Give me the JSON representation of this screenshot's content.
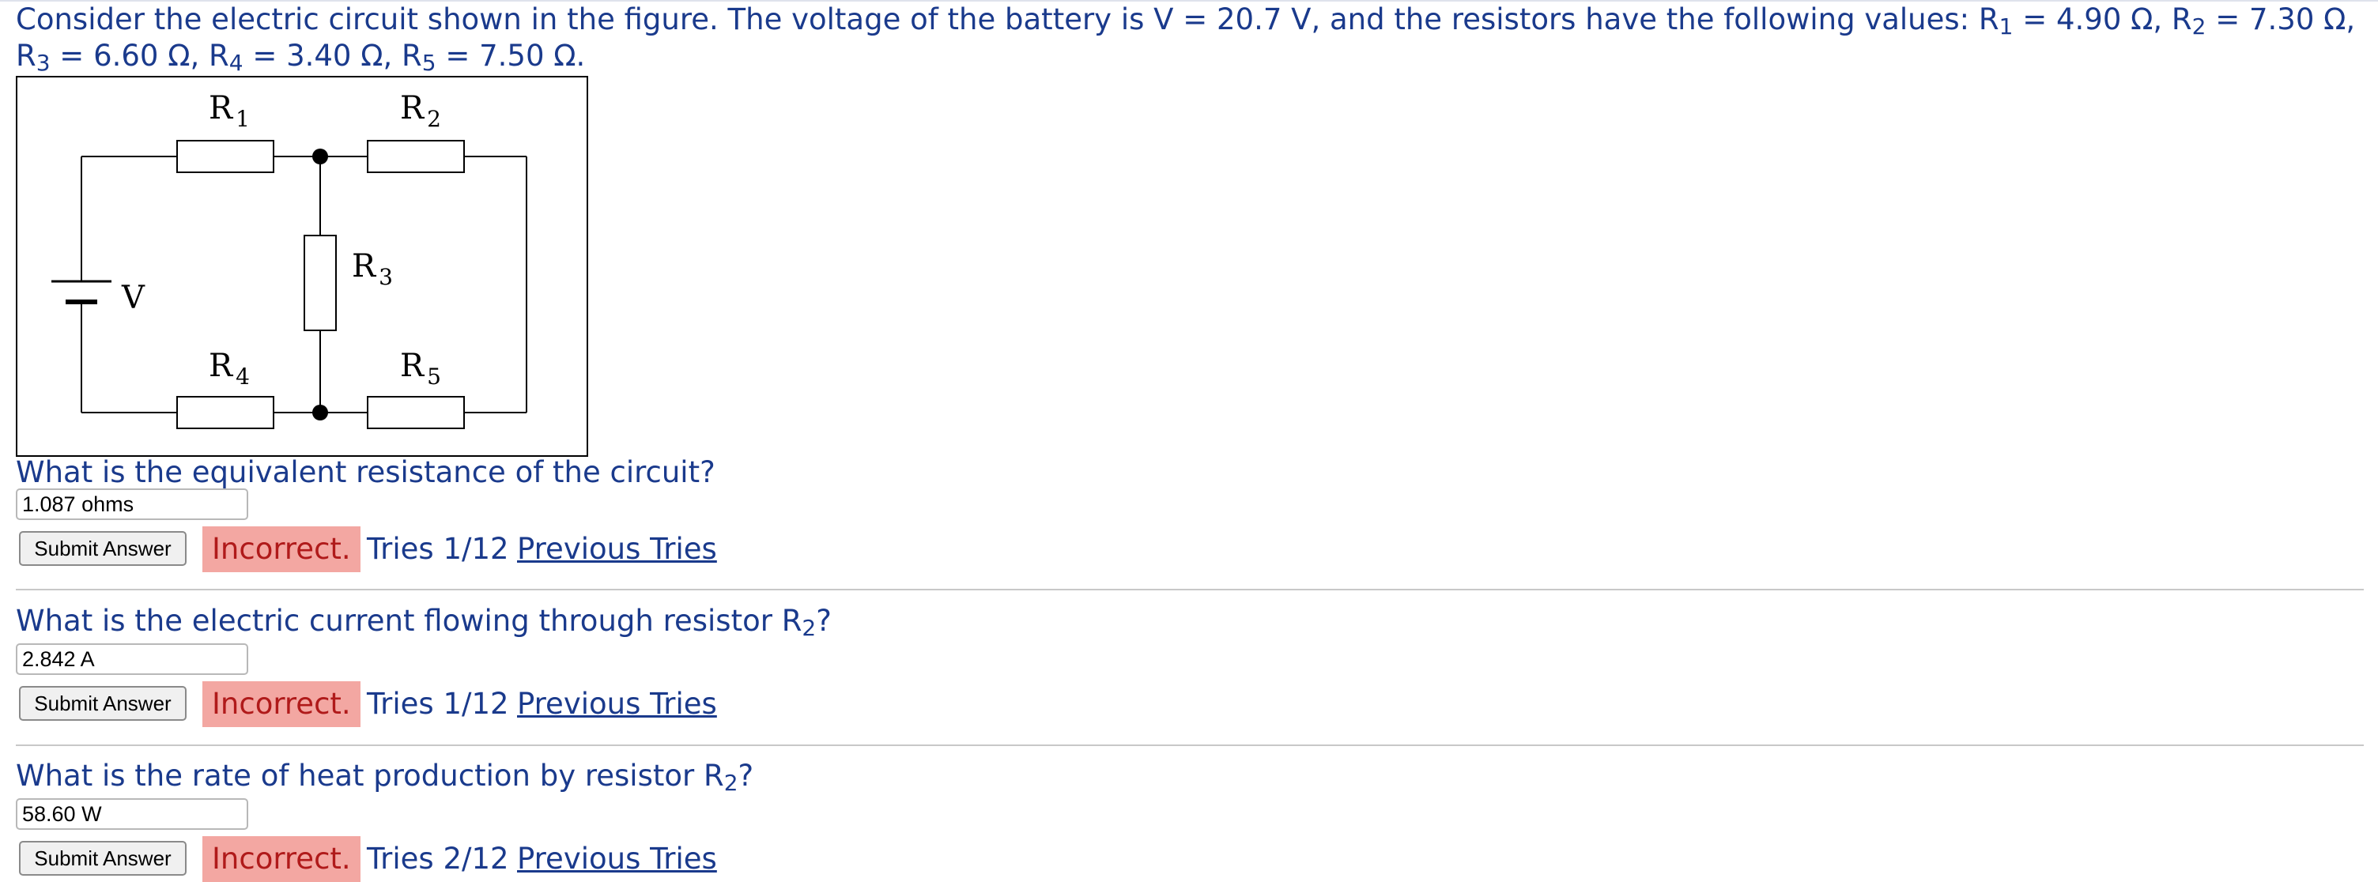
{
  "problem": {
    "intro": "Consider the electric circuit shown in the figure. The voltage of the battery is V = 20.7 V, and the resistors have the following values: R",
    "r1_sub": "1",
    "r1_val": " = 4.90 Ω, R",
    "r2_sub": "2",
    "r2_val": " = 7.30 Ω,",
    "r3_pre": "R",
    "r3_sub": "3",
    "r3_val": " = 6.60 Ω, R",
    "r4_sub": "4",
    "r4_val": " = 3.40 Ω, R",
    "r5_sub": "5",
    "r5_val": " = 7.50 Ω."
  },
  "figure": {
    "labels": {
      "r1": "R",
      "r1_sub": "1",
      "r2": "R",
      "r2_sub": "2",
      "r3": "R",
      "r3_sub": "3",
      "r4": "R",
      "r4_sub": "4",
      "r5": "R",
      "r5_sub": "5",
      "v": "V"
    }
  },
  "questions": [
    {
      "text": "What is the equivalent resistance of the circuit?",
      "answer": "1.087 ohms",
      "submit_label": "Submit Answer",
      "status": "Incorrect.",
      "tries": "Tries 1/12",
      "previous": "Previous Tries"
    },
    {
      "text_pre": "What is the electric current flowing through resistor R",
      "text_sub": "2",
      "text_post": "?",
      "answer": "2.842 A",
      "submit_label": "Submit Answer",
      "status": "Incorrect.",
      "tries": "Tries 1/12",
      "previous": "Previous Tries"
    },
    {
      "text_pre": "What is the rate of heat production by resistor R",
      "text_sub": "2",
      "text_post": "?",
      "answer": "58.60 W",
      "submit_label": "Submit Answer",
      "status": "Incorrect.",
      "tries": "Tries 2/12",
      "previous": "Previous Tries"
    }
  ],
  "colors": {
    "text": "#1a3a8c",
    "incorrect_bg": "#f3a7a2",
    "incorrect_text": "#b01a1a"
  }
}
